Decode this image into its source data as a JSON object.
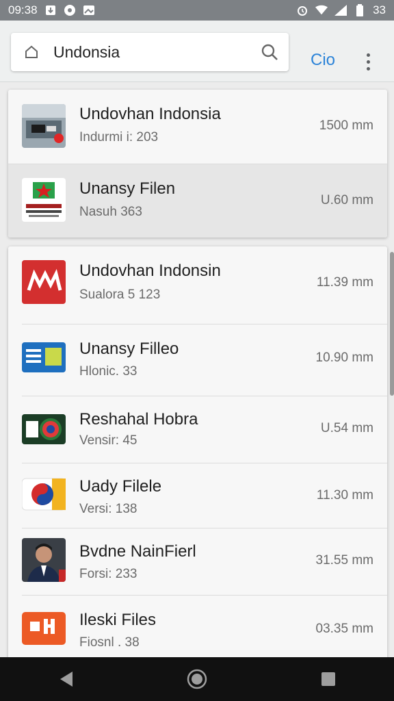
{
  "status_bar": {
    "time": "09:38",
    "right_text": "33"
  },
  "search": {
    "query": "Undonsia",
    "go_label": "Cio"
  },
  "top_card": [
    {
      "title": "Undovhan Indonsia",
      "subtitle": "Indurmi i: 203",
      "size": "1500 mm",
      "thumb": "newsroom-thumb"
    },
    {
      "title": "Unansy Filen",
      "subtitle": "Nasuh 363",
      "size": "U.60 mm",
      "thumb": "red-star-logo"
    }
  ],
  "bottom_card": [
    {
      "title": "Undovhan Indonsin",
      "subtitle": "Sualora 5 123",
      "size": "11.39 mm",
      "thumb": "red-m-logo"
    },
    {
      "title": "Unansy Filleo",
      "subtitle": "Hlonic. 33",
      "size": "10.90 mm",
      "thumb": "blue-doc-logo"
    },
    {
      "title": "Reshahal Hobra",
      "subtitle": "Vensir: 45",
      "size": "U.54 mm",
      "thumb": "green-r-logo"
    },
    {
      "title": "Uady Filele",
      "subtitle": "Versi: 138",
      "size": "11.30 mm",
      "thumb": "swirl-logo"
    },
    {
      "title": "Bvdne NainFierl",
      "subtitle": "Forsi: 233",
      "size": "31.55 mm",
      "thumb": "portrait-photo"
    },
    {
      "title": "Ileski Files",
      "subtitle": "Fiosnl . 38",
      "size": "03.35 mm",
      "thumb": "orange-grid-logo"
    }
  ],
  "colors": {
    "accent": "#2b83d8",
    "status_bar": "#7d8185",
    "nav_bar": "#111111"
  }
}
